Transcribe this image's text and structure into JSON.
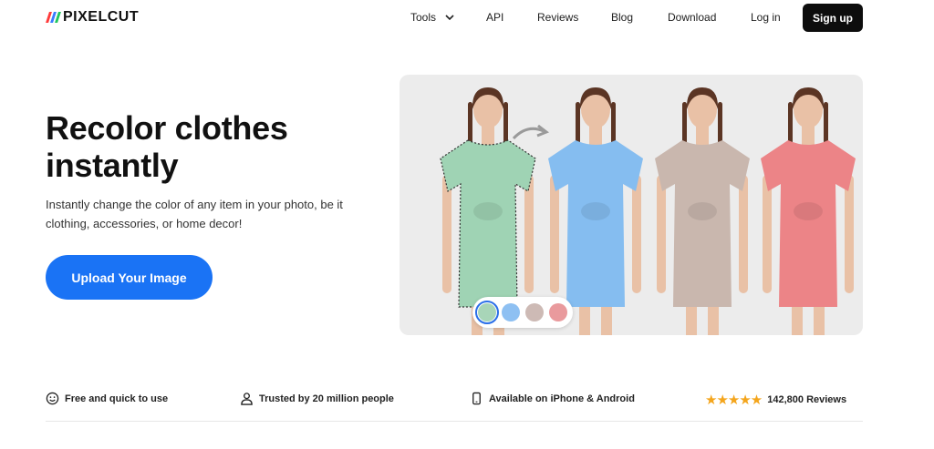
{
  "header": {
    "logo_text": "PIXELCUT",
    "nav": {
      "tools": "Tools",
      "api": "API",
      "reviews": "Reviews",
      "blog": "Blog",
      "download": "Download",
      "login": "Log in"
    },
    "signup": "Sign up"
  },
  "hero": {
    "title_line1": "Recolor clothes",
    "title_line2": "instantly",
    "subtitle": "Instantly change the color of any item in your photo, be it clothing, accessories, or home decor!",
    "cta": "Upload Your Image",
    "swatches": [
      "#a8d5b8",
      "#8ec0f2",
      "#cdbab5",
      "#e99a9d"
    ],
    "dress_colors": [
      "#9fd3b4",
      "#85bdf0",
      "#c9b7ae",
      "#ec8487"
    ]
  },
  "features": [
    {
      "icon": "smile-icon",
      "label": "Free and quick to use"
    },
    {
      "icon": "person-icon",
      "label": "Trusted by 20 million people"
    },
    {
      "icon": "phone-icon",
      "label": "Available on iPhone & Android"
    },
    {
      "icon": "star-icon",
      "label": "142,800 Reviews",
      "rating": 5
    }
  ],
  "colors": {
    "accent": "#1a73f5",
    "logo_stripes": [
      "#ff3b3b",
      "#3a7bff",
      "#22c55e"
    ]
  }
}
